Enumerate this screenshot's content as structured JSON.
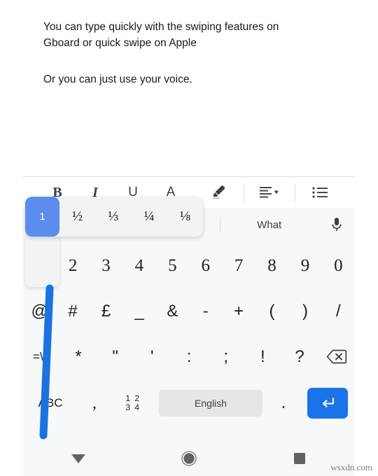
{
  "document": {
    "paragraphs": [
      "You can type quickly with the swiping features on\nGboard or quick swipe on Apple",
      "Or you can just use your voice."
    ]
  },
  "toolbar": {
    "bold_label": "B",
    "italic_label": "I",
    "underline_label": "U",
    "text_color_label": "A",
    "highlight_icon": "highlighter-pen-icon",
    "align_icon": "align-left-icon",
    "align_dropdown_icon": "chevron-down-icon",
    "list_icon": "bulleted-list-icon"
  },
  "keyboard": {
    "suggestions": [
      "",
      "",
      "What"
    ],
    "mic_icon": "microphone-icon",
    "row1": [
      "1",
      "2",
      "3",
      "4",
      "5",
      "6",
      "7",
      "8",
      "9",
      "0"
    ],
    "row2": [
      "@",
      "#",
      "£",
      "_",
      "&",
      "-",
      "+",
      "(",
      ")",
      "/"
    ],
    "row3": [
      "=\\<",
      "*",
      "\"",
      "'",
      ":",
      ";",
      "!",
      "?"
    ],
    "backspace_icon": "backspace-icon",
    "bottom": {
      "abc_label": "ABC",
      "comma_label": ",",
      "numeric_label_top": "1 2",
      "numeric_label_bottom": "3 4",
      "space_label": "English",
      "period_label": ".",
      "enter_icon": "enter-key-icon"
    },
    "popup": {
      "selected": "1",
      "options": [
        "½",
        "⅓",
        "¼",
        "⅛"
      ]
    },
    "swipe_trail_color": "#1b72e0",
    "enter_key_color": "#1a73e8",
    "selected_key_color": "#5b8def"
  },
  "navbar": {
    "back_icon": "down-triangle-back-icon",
    "home_icon": "circle-home-icon",
    "recents_icon": "square-recents-icon"
  },
  "watermark": {
    "text": "wsxdn.com"
  }
}
